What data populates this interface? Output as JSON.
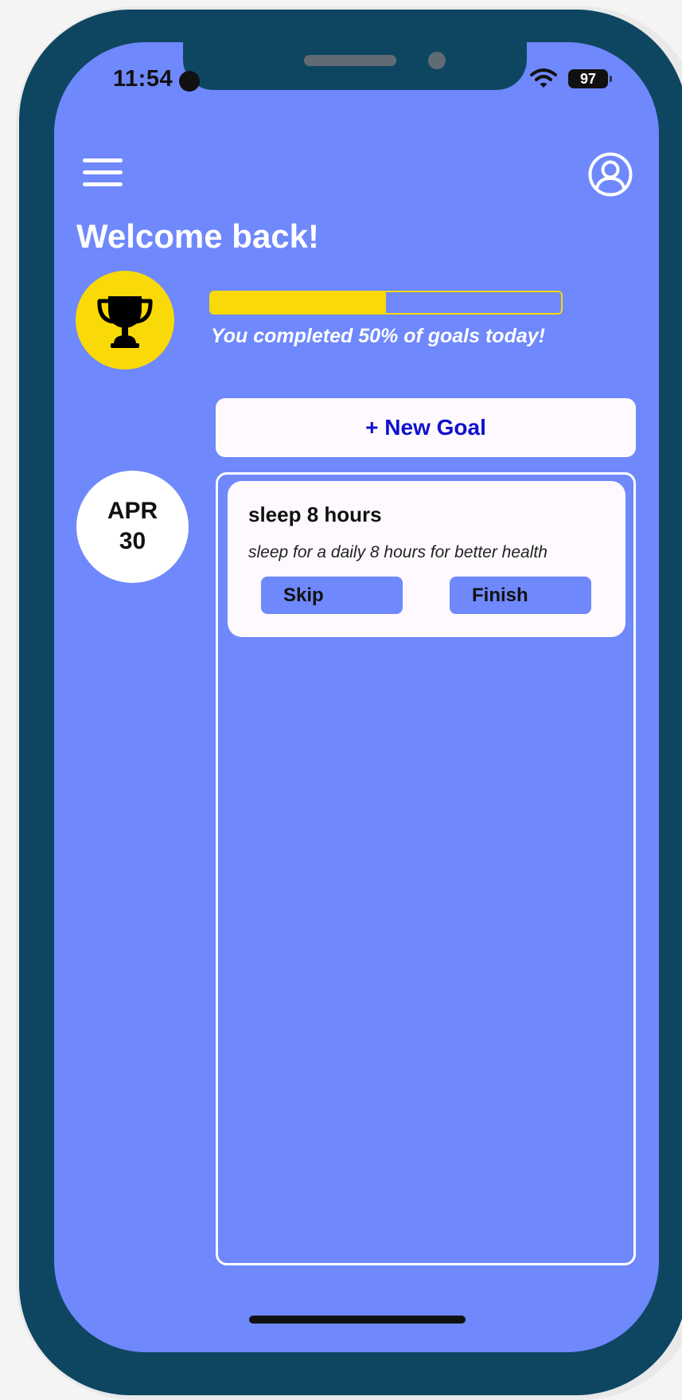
{
  "status_bar": {
    "time": "11:54",
    "battery": "97",
    "wifi_icon": "wifi-icon"
  },
  "header": {
    "menu_icon": "hamburger-menu-icon",
    "profile_icon": "user-profile-icon",
    "title": "Welcome back!"
  },
  "progress": {
    "trophy_icon": "trophy-icon",
    "percent": 50,
    "message": "You completed 50% of goals today!"
  },
  "actions": {
    "new_goal_label": "+ New Goal"
  },
  "date": {
    "month": "APR",
    "day": "30"
  },
  "goals": [
    {
      "title": "sleep 8 hours",
      "description": "sleep for a daily 8 hours for better health",
      "skip_label": "Skip",
      "finish_label": "Finish"
    }
  ],
  "colors": {
    "background": "#6f88fb",
    "frame": "#0e4662",
    "accent_yellow": "#f9d908",
    "button_text": "#1010cf",
    "card": "#fdf9fe"
  }
}
